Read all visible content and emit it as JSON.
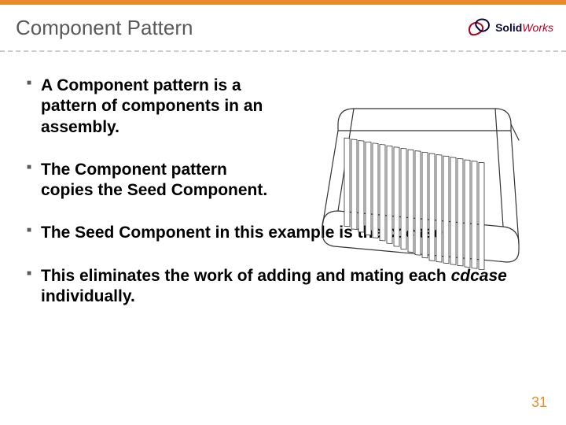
{
  "title": "Component Pattern",
  "logo": {
    "part1": "Solid",
    "part2": "Works"
  },
  "bullets": {
    "b1": "A Component pattern is a pattern of components in an assembly.",
    "b2": "The Component pattern copies the Seed Component.",
    "b3_a": "The Seed Component in this example is the ",
    "b3_b": "cdcase",
    "b3_c": ".",
    "b4_a": "This eliminates the work of adding and mating each ",
    "b4_b": "cdcase",
    "b4_c": " individually."
  },
  "page_number": "31"
}
